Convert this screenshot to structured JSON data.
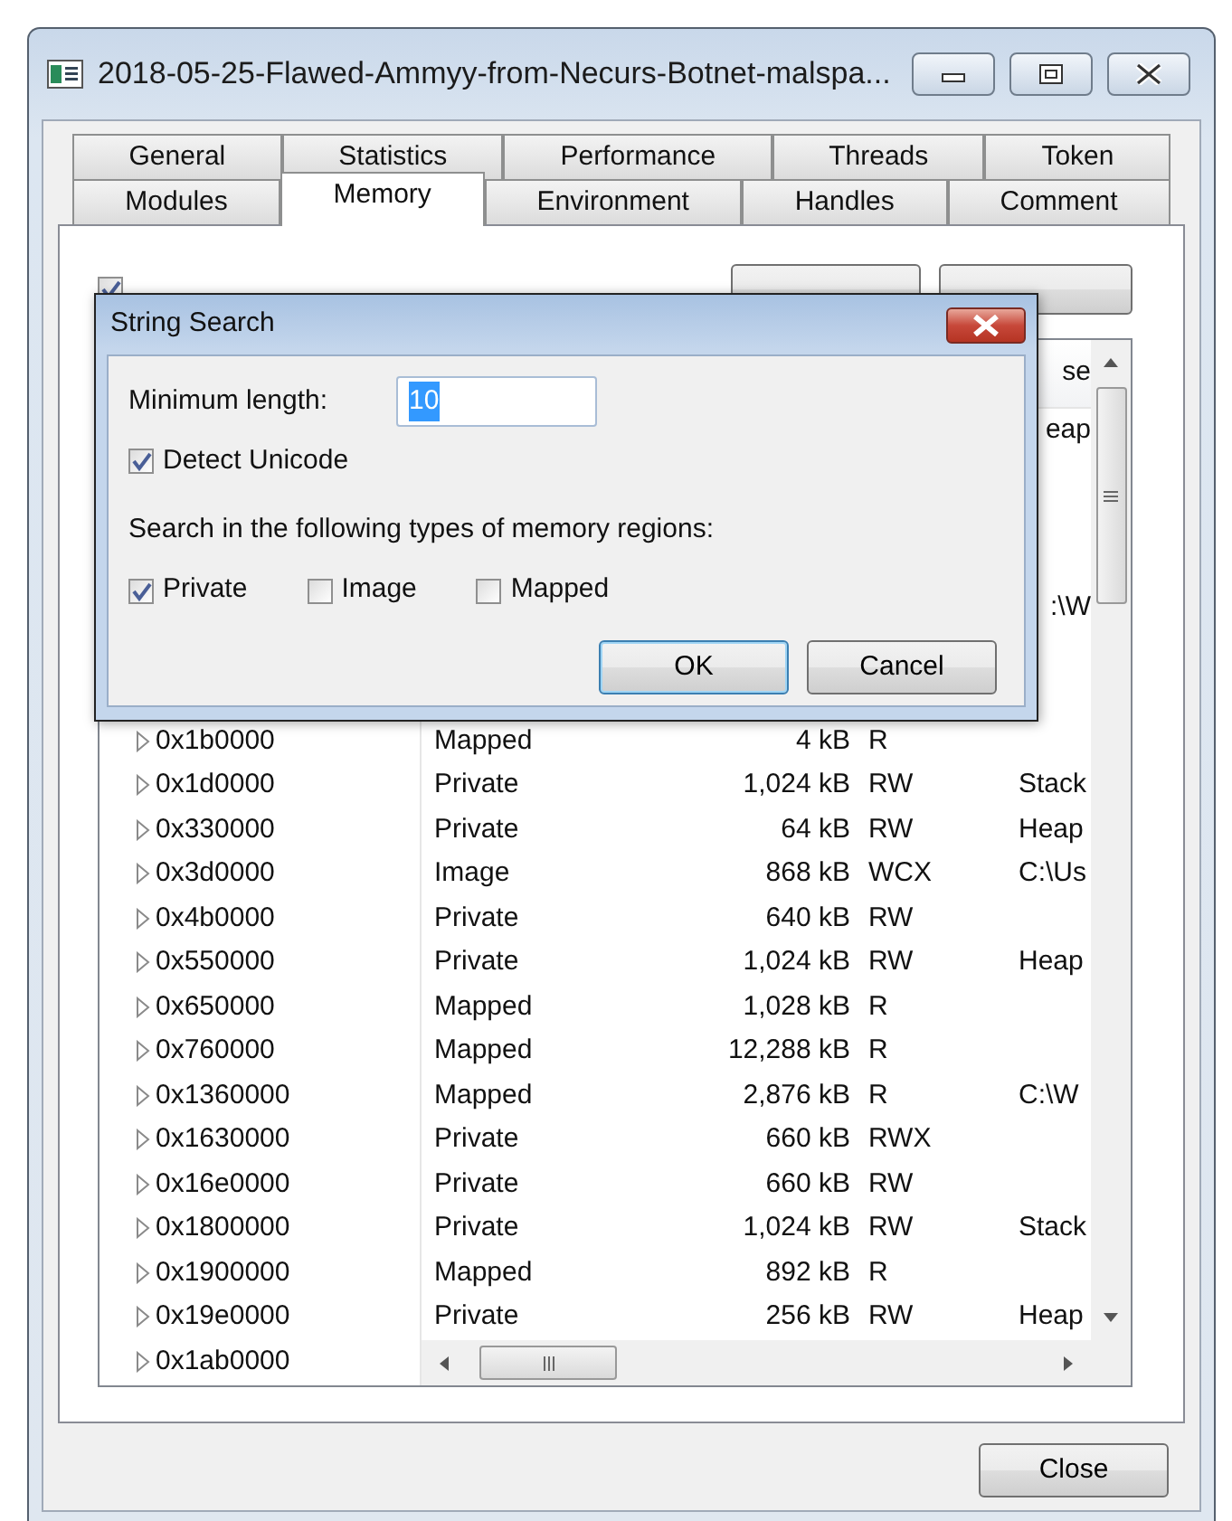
{
  "window": {
    "title": "2018-05-25-Flawed-Ammyy-from-Necurs-Botnet-malspa..."
  },
  "tabs": [
    [
      {
        "label": "General",
        "selected": false
      },
      {
        "label": "Statistics",
        "selected": false
      },
      {
        "label": "Performance",
        "selected": false
      },
      {
        "label": "Threads",
        "selected": false
      },
      {
        "label": "Token",
        "selected": false
      }
    ],
    [
      {
        "label": "Modules",
        "selected": false
      },
      {
        "label": "Memory",
        "selected": true
      },
      {
        "label": "Environment",
        "selected": false
      },
      {
        "label": "Handles",
        "selected": false
      },
      {
        "label": "Comment",
        "selected": false
      }
    ]
  ],
  "hide_free_regions": {
    "checked": true
  },
  "buttons": [
    {
      "kind": "button"
    },
    {
      "kind": "button"
    }
  ],
  "table": {
    "header_fragment": "se",
    "covered_rows": [
      {
        "use": "eap"
      },
      {},
      {},
      {},
      {
        "use": ":\\W"
      },
      {},
      {}
    ],
    "rows": [
      {
        "address": "0x1b0000",
        "type": "Mapped",
        "size": "4 kB",
        "protection": "R"
      },
      {
        "address": "0x1d0000",
        "type": "Private",
        "size": "1,024 kB",
        "protection": "RW",
        "use": "Stack"
      },
      {
        "address": "0x330000",
        "type": "Private",
        "size": "64 kB",
        "protection": "RW",
        "use": "Heap"
      },
      {
        "address": "0x3d0000",
        "type": "Image",
        "size": "868 kB",
        "protection": "WCX",
        "use": "C:\\Us"
      },
      {
        "address": "0x4b0000",
        "type": "Private",
        "size": "640 kB",
        "protection": "RW"
      },
      {
        "address": "0x550000",
        "type": "Private",
        "size": "1,024 kB",
        "protection": "RW",
        "use": "Heap"
      },
      {
        "address": "0x650000",
        "type": "Mapped",
        "size": "1,028 kB",
        "protection": "R"
      },
      {
        "address": "0x760000",
        "type": "Mapped",
        "size": "12,288 kB",
        "protection": "R"
      },
      {
        "address": "0x1360000",
        "type": "Mapped",
        "size": "2,876 kB",
        "protection": "R",
        "use": "C:\\W"
      },
      {
        "address": "0x1630000",
        "type": "Private",
        "size": "660 kB",
        "protection": "RWX"
      },
      {
        "address": "0x16e0000",
        "type": "Private",
        "size": "660 kB",
        "protection": "RW"
      },
      {
        "address": "0x1800000",
        "type": "Private",
        "size": "1,024 kB",
        "protection": "RW",
        "use": "Stack"
      },
      {
        "address": "0x1900000",
        "type": "Mapped",
        "size": "892 kB",
        "protection": "R"
      },
      {
        "address": "0x19e0000",
        "type": "Private",
        "size": "256 kB",
        "protection": "RW",
        "use": "Heap"
      },
      {
        "address": "0x1ab0000"
      }
    ]
  },
  "close_button": "Close",
  "dialog": {
    "title": "String Search",
    "min_length_label": "Minimum length:",
    "min_length_value": "10",
    "value_selected": true,
    "detect_unicode": {
      "label": "Detect Unicode",
      "checked": true
    },
    "regions_label": "Search in the following types of memory regions:",
    "region_types": [
      {
        "label": "Private",
        "checked": true
      },
      {
        "label": "Image",
        "checked": false
      },
      {
        "label": "Mapped",
        "checked": false
      }
    ],
    "buttons": [
      {
        "label": "OK",
        "default": true
      },
      {
        "label": "Cancel",
        "default": false
      }
    ]
  }
}
